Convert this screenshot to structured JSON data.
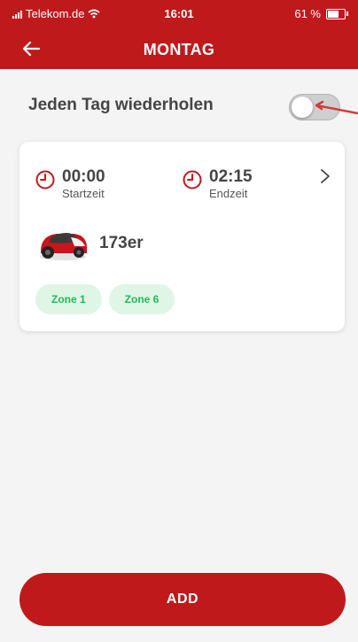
{
  "status_bar": {
    "carrier": "Telekom.de",
    "time": "16:01",
    "battery": "61 %",
    "battery_level": 0.61
  },
  "header": {
    "title": "MONTAG",
    "back_icon": "arrow-left-icon"
  },
  "repeat": {
    "label": "Jeden Tag wiederholen",
    "toggle_on": false
  },
  "schedule": {
    "start_time": "00:00",
    "start_label": "Startzeit",
    "end_time": "02:15",
    "end_label": "Endzeit",
    "mower_name": "173er",
    "zones": [
      "Zone 1",
      "Zone 6"
    ]
  },
  "add_button": {
    "label": "ADD"
  },
  "colors": {
    "brand": "#c0191c",
    "zone_bg": "#dff5e6",
    "zone_text": "#21b85a"
  }
}
